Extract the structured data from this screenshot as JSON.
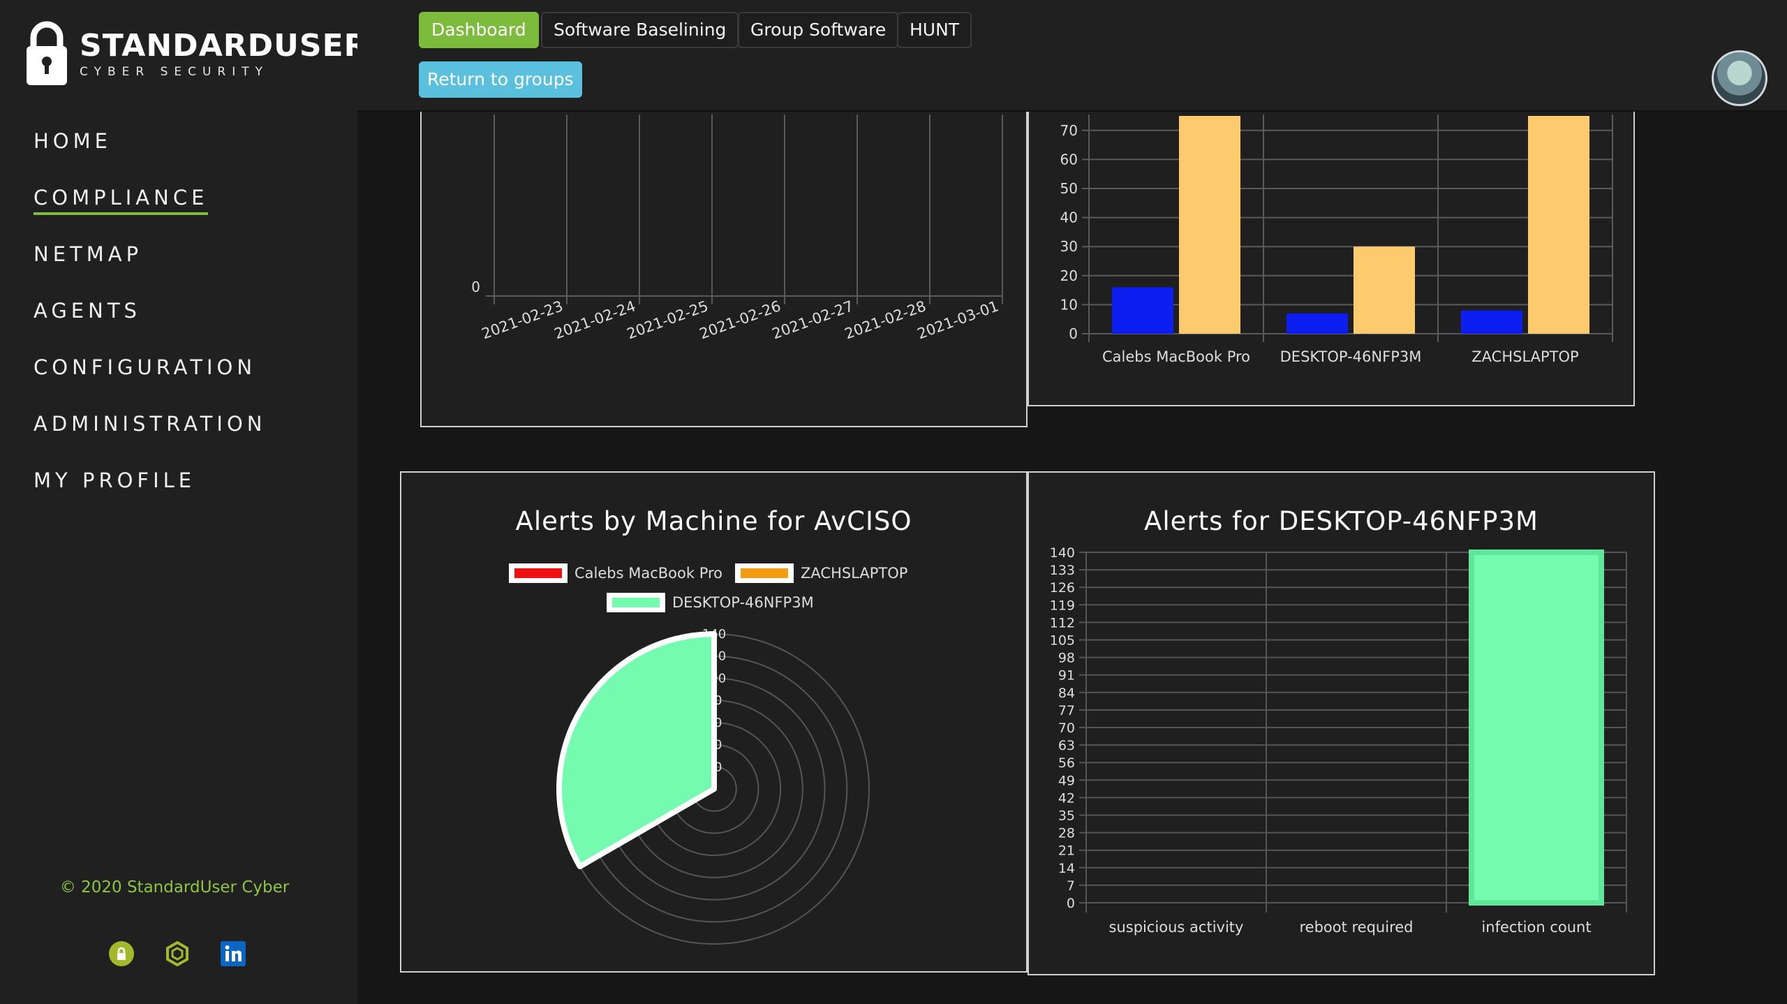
{
  "brand": {
    "title": "STANDARDUSER",
    "subtitle": "CYBER SECURITY"
  },
  "nav": {
    "home": "HOME",
    "compliance": "COMPLIANCE",
    "netmap": "NETMAP",
    "agents": "AGENTS",
    "configuration": "CONFIGURATION",
    "administration": "ADMINISTRATION",
    "my_profile": "MY PROFILE"
  },
  "footer": {
    "copyright": "© 2020 StandardUser Cyber",
    "icons": [
      "lock-icon",
      "hexagon-badge-icon",
      "linkedin-icon"
    ]
  },
  "tabs": {
    "dashboard": "Dashboard",
    "software_baselining": "Software Baselining",
    "group_software": "Group Software",
    "hunt": "HUNT",
    "return_to_groups": "Return to groups"
  },
  "colors": {
    "accent_green": "#7dbb3c",
    "button_blue": "#5bc0de",
    "bar_blue": "#0d1ff0",
    "bar_yellow": "#fdcb6e",
    "mint": "#75fbb0",
    "red": "#ee1111",
    "orange": "#f39c12"
  },
  "chart_data": [
    {
      "type": "line",
      "x": [
        "2021-02-23",
        "2021-02-24",
        "2021-02-25",
        "2021-02-26",
        "2021-02-27",
        "2021-02-28",
        "2021-03-01"
      ],
      "y_tick_labels": [
        "0"
      ],
      "series": []
    },
    {
      "type": "bar",
      "categories": [
        "Calebs MacBook Pro",
        "DESKTOP-46NFP3M",
        "ZACHSLAPTOP"
      ],
      "series": [
        {
          "values": [
            16,
            7,
            8
          ],
          "color": "#0d1ff0"
        },
        {
          "values": [
            75,
            30,
            75
          ],
          "color": "#fdcb6e"
        }
      ],
      "y_ticks": [
        0,
        10,
        20,
        30,
        40,
        50,
        60,
        70
      ]
    },
    {
      "type": "pie",
      "title": "Alerts by Machine for AvCISO",
      "labels": [
        "Calebs MacBook Pro",
        "ZACHSLAPTOP",
        "DESKTOP-46NFP3M"
      ],
      "colors": [
        "#ee1111",
        "#f39c12",
        "#75fbb0"
      ],
      "values": [
        0,
        0,
        140
      ],
      "r_max": 140
    },
    {
      "type": "bar",
      "title": "Alerts for DESKTOP-46NFP3M",
      "categories": [
        "suspicious activity",
        "reboot required",
        "infection count"
      ],
      "values": [
        0,
        0,
        140
      ],
      "y_ticks": [
        0,
        7,
        14,
        21,
        28,
        35,
        42,
        49,
        56,
        63,
        70,
        77,
        84,
        91,
        98,
        105,
        112,
        119,
        126,
        133,
        140
      ],
      "ylim": [
        0,
        140
      ]
    }
  ]
}
